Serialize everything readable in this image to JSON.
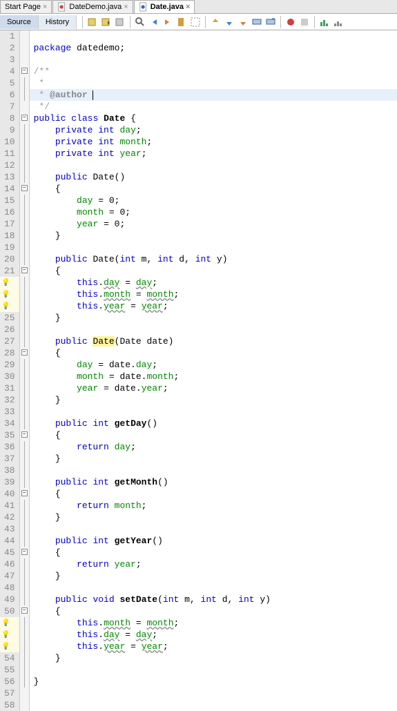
{
  "tabs": [
    {
      "label": "Start Page",
      "active": false
    },
    {
      "label": "DateDemo.java",
      "active": false
    },
    {
      "label": "Date.java",
      "active": true
    }
  ],
  "subtabs": {
    "source": "Source",
    "history": "History"
  },
  "lines": {
    "l2_package": "package",
    "l2_name": "datedemo",
    "l4": "/**",
    "l5": " *",
    "l6_prefix": " * ",
    "l6_tag": "@author",
    "l7": " */",
    "l8_public": "public",
    "l8_class": "class",
    "l8_name": "Date",
    "private": "private",
    "int": "int",
    "day": "day",
    "month": "month",
    "year": "year",
    "public": "public",
    "void": "void",
    "this": "this",
    "return": "return",
    "Date": "Date",
    "getDay": "getDay",
    "getMonth": "getMonth",
    "getYear": "getYear",
    "setDate": "setDate",
    "date": "date",
    "m": "m",
    "d": "d",
    "y": "y",
    "zero": "0"
  },
  "line_numbers": [
    "1",
    "2",
    "3",
    "4",
    "5",
    "6",
    "7",
    "8",
    "9",
    "10",
    "11",
    "12",
    "13",
    "14",
    "15",
    "16",
    "17",
    "18",
    "19",
    "20",
    "21",
    "",
    "",
    "",
    "25",
    "26",
    "27",
    "28",
    "29",
    "30",
    "31",
    "32",
    "33",
    "34",
    "35",
    "36",
    "37",
    "38",
    "39",
    "40",
    "41",
    "42",
    "43",
    "44",
    "45",
    "46",
    "47",
    "48",
    "49",
    "50",
    "",
    "",
    "",
    "54",
    "55",
    "56",
    "57",
    "58"
  ],
  "lamp_rows": [
    22,
    23,
    24,
    51,
    52,
    53
  ],
  "fold_boxes": [
    4,
    8,
    14,
    21,
    28,
    35,
    40,
    45,
    50
  ]
}
